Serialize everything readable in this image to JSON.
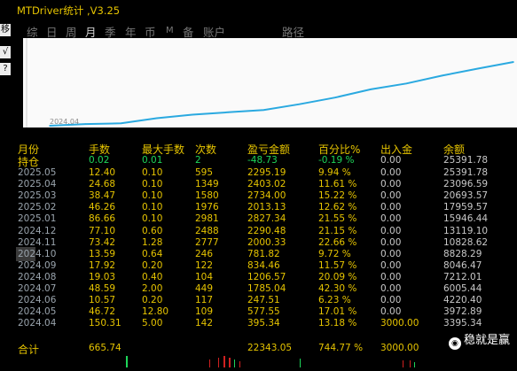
{
  "window": {
    "title": "MTDriver统计 ,V3.25",
    "left_buttons": [
      "移",
      "√",
      "?"
    ]
  },
  "nav": {
    "items": [
      "综",
      "日",
      "周",
      "月",
      "季",
      "年",
      "币",
      "M",
      "备",
      "账户",
      "路径"
    ],
    "active": "月"
  },
  "chart_data": {
    "type": "line",
    "x_tick_labels": [
      "2024.04"
    ],
    "x": [
      "2024.04",
      "2024.05",
      "2024.06",
      "2024.07",
      "2024.08",
      "2024.09",
      "2024.10",
      "2024.11",
      "2024.12",
      "2025.01",
      "2025.02",
      "2025.03",
      "2025.04",
      "2025.05"
    ],
    "series": [
      {
        "values": [
          3395.34,
          3972.89,
          4220.4,
          6005.44,
          7212.01,
          8046.47,
          8828.29,
          10828.62,
          13119.1,
          15946.44,
          17959.57,
          20693.57,
          23096.59,
          25391.78
        ],
        "color": "#2aa9e0"
      }
    ]
  },
  "table": {
    "headers": [
      "月份",
      "手数",
      "最大手数",
      "次数",
      "盈亏金额",
      "百分比%",
      "出入金",
      "余额"
    ],
    "holding": {
      "label": "持仓",
      "lots": "0.02",
      "max_lots": "0.01",
      "count": "2",
      "pnl": "-48.73",
      "percent": "-0.19 %",
      "flow": "0.00",
      "balance": "25391.78"
    },
    "rows": [
      {
        "month": "2025.05",
        "lots": "12.40",
        "max_lots": "0.10",
        "count": "595",
        "pnl": "2295.19",
        "percent": "9.94 %",
        "flow": "0.00",
        "balance": "25391.78"
      },
      {
        "month": "2025.04",
        "lots": "24.68",
        "max_lots": "0.10",
        "count": "1349",
        "pnl": "2403.02",
        "percent": "11.61 %",
        "flow": "0.00",
        "balance": "23096.59"
      },
      {
        "month": "2025.03",
        "lots": "38.47",
        "max_lots": "0.10",
        "count": "1580",
        "pnl": "2734.00",
        "percent": "15.22 %",
        "flow": "0.00",
        "balance": "20693.57"
      },
      {
        "month": "2025.02",
        "lots": "46.26",
        "max_lots": "0.10",
        "count": "1976",
        "pnl": "2013.13",
        "percent": "12.62 %",
        "flow": "0.00",
        "balance": "17959.57"
      },
      {
        "month": "2025.01",
        "lots": "86.66",
        "max_lots": "0.10",
        "count": "2981",
        "pnl": "2827.34",
        "percent": "21.55 %",
        "flow": "0.00",
        "balance": "15946.44"
      },
      {
        "month": "2024.12",
        "lots": "77.10",
        "max_lots": "0.60",
        "count": "2488",
        "pnl": "2290.48",
        "percent": "21.15 %",
        "flow": "0.00",
        "balance": "13119.10"
      },
      {
        "month": "2024.11",
        "lots": "73.42",
        "max_lots": "1.28",
        "count": "2777",
        "pnl": "2000.33",
        "percent": "22.66 %",
        "flow": "0.00",
        "balance": "10828.62"
      },
      {
        "month": "2024.10",
        "lots": "13.59",
        "max_lots": "0.64",
        "count": "246",
        "pnl": "781.82",
        "percent": "9.72 %",
        "flow": "0.00",
        "balance": "8828.29"
      },
      {
        "month": "2024.09",
        "lots": "17.92",
        "max_lots": "0.20",
        "count": "122",
        "pnl": "834.46",
        "percent": "11.57 %",
        "flow": "0.00",
        "balance": "8046.47"
      },
      {
        "month": "2024.08",
        "lots": "19.03",
        "max_lots": "0.40",
        "count": "104",
        "pnl": "1206.57",
        "percent": "20.09 %",
        "flow": "0.00",
        "balance": "7212.01"
      },
      {
        "month": "2024.07",
        "lots": "48.59",
        "max_lots": "2.00",
        "count": "449",
        "pnl": "1785.04",
        "percent": "42.30 %",
        "flow": "0.00",
        "balance": "6005.44"
      },
      {
        "month": "2024.06",
        "lots": "10.57",
        "max_lots": "0.20",
        "count": "117",
        "pnl": "247.51",
        "percent": "6.23 %",
        "flow": "0.00",
        "balance": "4220.40"
      },
      {
        "month": "2024.05",
        "lots": "46.72",
        "max_lots": "12.80",
        "count": "109",
        "pnl": "577.55",
        "percent": "17.01 %",
        "flow": "0.00",
        "balance": "3972.89"
      },
      {
        "month": "2024.04",
        "lots": "150.31",
        "max_lots": "5.00",
        "count": "142",
        "pnl": "395.34",
        "percent": "13.18 %",
        "flow": "3000.00",
        "balance": "3395.34"
      }
    ],
    "total": {
      "label": "合计",
      "lots": "665.74",
      "pnl": "22343.05",
      "percent": "744.77 %",
      "flow": "3000.00"
    }
  },
  "watermark": {
    "text": "稳就是赢",
    "icon": "wechat-icon"
  }
}
